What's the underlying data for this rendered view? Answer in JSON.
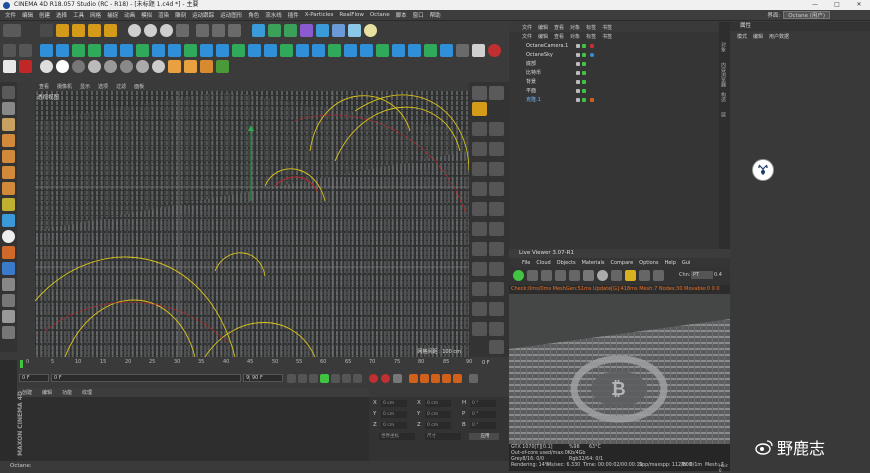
{
  "titlebar": {
    "title": "CINEMA 4D R18.057 Studio (RC - R18) - [未标题 1.c4d *] - 主要",
    "min": "—",
    "max": "□",
    "close": "✕"
  },
  "menu": [
    "文件",
    "编辑",
    "创建",
    "选择",
    "工具",
    "网格",
    "捕捉",
    "动画",
    "模拟",
    "渲染",
    "雕刻",
    "运动跟踪",
    "运动图形",
    "角色",
    "流水线",
    "插件",
    "X-Particles",
    "RealFlow",
    "Octane",
    "脚本",
    "窗口",
    "帮助"
  ],
  "layout": {
    "label": "界面:",
    "value": "Octane (用户)"
  },
  "viewport": {
    "menu": [
      "查看",
      "摄像机",
      "显示",
      "选项",
      "过滤",
      "面板"
    ],
    "label": "透视视图",
    "grid_label": "网格间距 : 100 cm"
  },
  "timeline": {
    "ticks": [
      "0",
      "5",
      "10",
      "15",
      "20",
      "25",
      "30",
      "35",
      "40",
      "45",
      "50",
      "55",
      "60",
      "65",
      "70",
      "75",
      "80",
      "85",
      "90"
    ],
    "end_label": "0 F"
  },
  "playbar": {
    "start": "0 F",
    "current": "0 F",
    "end_a": "90 F",
    "end_b": "90 F"
  },
  "materials": {
    "menu": [
      "创建",
      "编辑",
      "功能",
      "纹理"
    ]
  },
  "coords": {
    "rows": [
      {
        "axis": "X",
        "pos": "0 cm",
        "axis2": "X",
        "size": "0 cm",
        "rot_axis": "H",
        "rot": "0 °"
      },
      {
        "axis": "Y",
        "pos": "0 cm",
        "axis2": "Y",
        "size": "0 cm",
        "rot_axis": "P",
        "rot": "0 °"
      },
      {
        "axis": "Z",
        "pos": "0 cm",
        "axis2": "Z",
        "size": "0 cm",
        "rot_axis": "B",
        "rot": "0 °"
      }
    ],
    "mode": "世界坐标",
    "size_mode": "尺寸",
    "apply": "应用"
  },
  "maxon": "MAXON CINEMA 4D",
  "status": "Octane:",
  "objects": {
    "menu": [
      "文件",
      "编辑",
      "查看",
      "对象",
      "标签",
      "书签"
    ],
    "items": [
      {
        "name": "OctaneCamera.1",
        "indent": 1
      },
      {
        "name": "OctaneSky",
        "indent": 1
      },
      {
        "name": "底部",
        "indent": 0
      },
      {
        "name": "比特币",
        "indent": 0
      },
      {
        "name": "背景",
        "indent": 0
      },
      {
        "name": "平面",
        "indent": 0
      },
      {
        "name": "克隆.1",
        "indent": 0
      }
    ]
  },
  "attributes": {
    "title": "属性",
    "menu": [
      "模式",
      "编辑",
      "用户数据"
    ],
    "tabs": [
      "对象",
      "内容浏览器",
      "构造",
      "层"
    ]
  },
  "liveviewer": {
    "title": "Live Viewer 3.07-R1",
    "menu": [
      "File",
      "Cloud",
      "Objects",
      "Materials",
      "Compare",
      "Options",
      "Help",
      "Gui"
    ],
    "channel": "Chn:",
    "channel_value": "PT",
    "zoom": "0.4",
    "status": "Check:0ms/0ms  MeshGen:51ms  Update[G]:418ms  Mesh:7 Nodes:30 Movable:0 0 0",
    "info": {
      "gpu": "GTX 1070[T][0.1]",
      "gpu_pct": "%98",
      "gpu_temp": "63°C",
      "ooc": "Out-of-core used/max:0Kb/4Gb",
      "grey": "Grey8/16: 0/0",
      "rgb": "Rgb32/64: 0/1",
      "vram": "Used/free/total vram: 474Mb/5.817Gb/8Gb",
      "vram_tag": "Main_Scene",
      "rendering": "Rendering: 14%",
      "ms": "Ms/sec: 6.330",
      "time": "Time: 00:00:02/00:00:10",
      "spp": "Spp/maxspp: 112/800",
      "tri": "Tri: 0/1m",
      "mesh": "Mesh: 7",
      "hair": "Hair: 0"
    }
  },
  "watermark": {
    "text": "野鹿志"
  },
  "colors": {
    "accent_orange": "#e8702a",
    "octane_green": "#41c441",
    "spline_yellow": "#d8c21a",
    "spline_red": "#c0262a"
  }
}
